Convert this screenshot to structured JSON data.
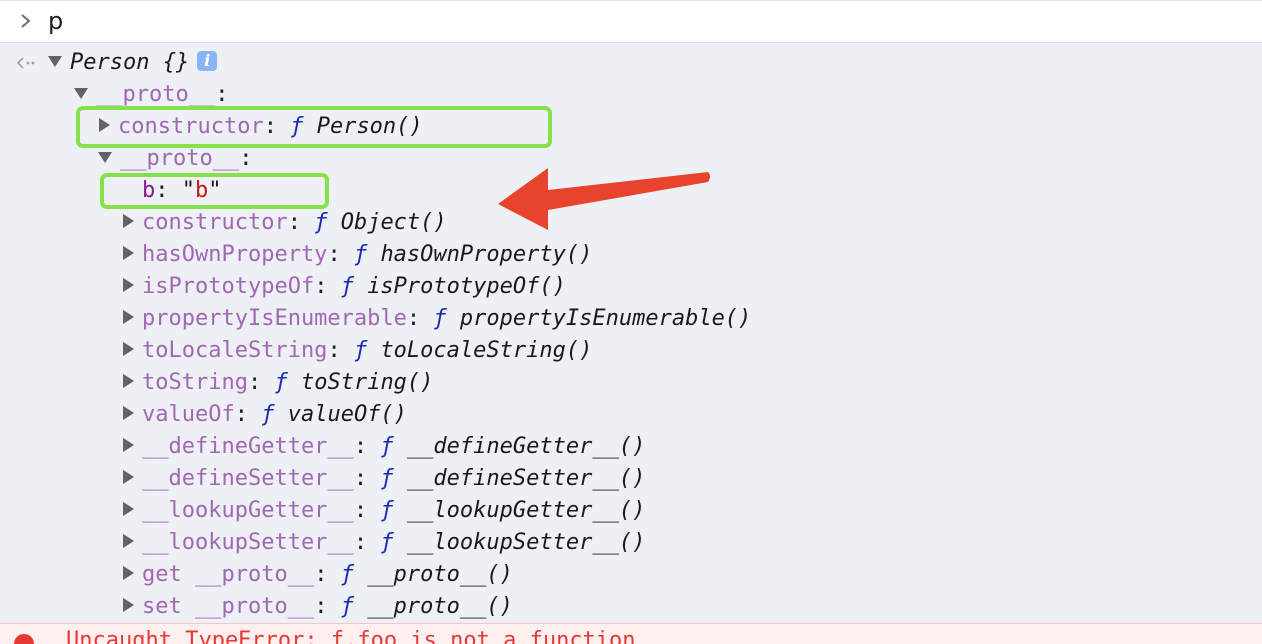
{
  "console": {
    "input": "p",
    "root": {
      "name": "Person",
      "braces": "{}",
      "info_badge": "i"
    },
    "level1_proto": {
      "key": "__proto__",
      "colon": ":"
    },
    "level1_constructor": {
      "key": "constructor",
      "colon": ":",
      "f": "ƒ",
      "value": "Person()"
    },
    "level2_proto": {
      "key": "__proto__",
      "colon": ":"
    },
    "own_prop": {
      "key": "b",
      "colon": ":",
      "value_open": "\"",
      "value": "b",
      "value_close": "\""
    },
    "object_members": [
      {
        "key": "constructor",
        "colon": ":",
        "f": "ƒ",
        "value": "Object()"
      },
      {
        "key": "hasOwnProperty",
        "colon": ":",
        "f": "ƒ",
        "value": "hasOwnProperty()"
      },
      {
        "key": "isPrototypeOf",
        "colon": ":",
        "f": "ƒ",
        "value": "isPrototypeOf()"
      },
      {
        "key": "propertyIsEnumerable",
        "colon": ":",
        "f": "ƒ",
        "value": "propertyIsEnumerable()"
      },
      {
        "key": "toLocaleString",
        "colon": ":",
        "f": "ƒ",
        "value": "toLocaleString()"
      },
      {
        "key": "toString",
        "colon": ":",
        "f": "ƒ",
        "value": "toString()"
      },
      {
        "key": "valueOf",
        "colon": ":",
        "f": "ƒ",
        "value": "valueOf()"
      },
      {
        "key": "__defineGetter__",
        "colon": ":",
        "f": "ƒ",
        "value": "__defineGetter__()"
      },
      {
        "key": "__defineSetter__",
        "colon": ":",
        "f": "ƒ",
        "value": "__defineSetter__()"
      },
      {
        "key": "__lookupGetter__",
        "colon": ":",
        "f": "ƒ",
        "value": "__lookupGetter__()"
      },
      {
        "key": "__lookupSetter__",
        "colon": ":",
        "f": "ƒ",
        "value": "__lookupSetter__()"
      },
      {
        "key": "get __proto__",
        "colon": ":",
        "f": "ƒ",
        "value": "__proto__()"
      },
      {
        "key": "set __proto__",
        "colon": ":",
        "f": "ƒ",
        "value": "__proto__()"
      }
    ],
    "error_text": "Uncaught TypeError: f.foo is not a function"
  },
  "colors": {
    "highlight_box": "#86e04a",
    "annotation_arrow": "#e8432d",
    "key_inherited": "#a366b5",
    "key_own": "#8a1a8f",
    "function_f": "#1a2bb0",
    "string_value": "#c41a16",
    "output_background": "#edf0f5"
  },
  "icons": {
    "prompt": "chevron-right-icon",
    "result": "result-arrow-icon",
    "info": "info-icon",
    "error": "error-icon"
  }
}
